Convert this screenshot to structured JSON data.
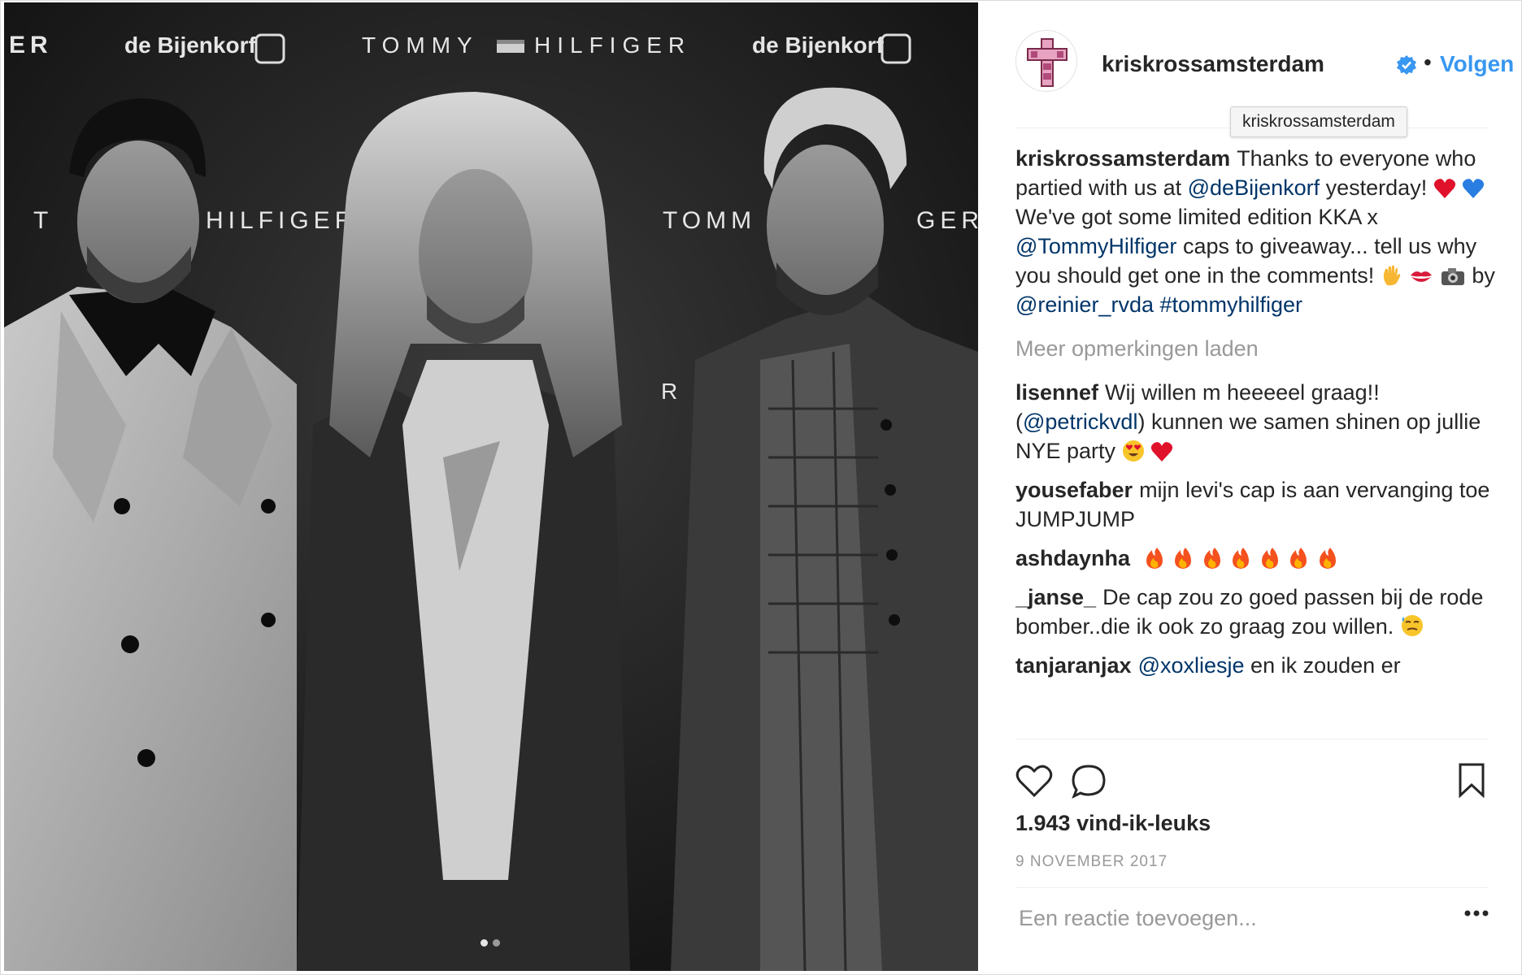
{
  "photo": {
    "backdrop_texts": [
      "ER",
      "de Bijenkorf",
      "TOMMY",
      "HILFIGER",
      "de Bijenkorf",
      "T",
      "HILFIGER",
      "TOMM",
      "GER",
      "R"
    ],
    "carousel_dots": 2,
    "active_dot": 0
  },
  "post": {
    "username": "kriskrossamsterdam",
    "follow_label": "Volgen",
    "separator": "•",
    "tooltip": "kriskrossamsterdam",
    "caption": {
      "user": "kriskrossamsterdam",
      "t1": "Thanks to everyone who partied with us at",
      "m1": "@deBijenkorf",
      "t2": "yesterday!",
      "t3": "We've got some limited edition KKA x",
      "m2": "@TommyHilfiger",
      "t4": "caps to giveaway... tell us why you should get one in the comments!",
      "t5": "by",
      "m3": "@reinier_rvda",
      "m4": "#tommyhilfiger"
    },
    "load_more": "Meer opmerkingen laden",
    "comments": [
      {
        "user": "lisennef",
        "t1": "Wij willen m heeeeel graag!! (",
        "m1": "@petrickvdl",
        "t2": ") kunnen we samen shinen op jullie NYE party"
      },
      {
        "user": "yousefaber",
        "t1": "mijn levi's cap is aan vervanging toe JUMPJUMP"
      },
      {
        "user": "ashdaynha",
        "t1": ""
      },
      {
        "user": "_janse_",
        "t1": "De cap zou zo goed passen bij de rode bomber..die ik ook zo graag zou willen."
      },
      {
        "user": "tanjaranjax",
        "m1": "@xoxliesje",
        "t1": "en ik zouden er"
      }
    ],
    "likes": "1.943 vind-ik-leuks",
    "date": "9 NOVEMBER 2017",
    "comment_placeholder": "Een reactie toevoegen..."
  },
  "icons": {
    "like": "heart-outline-icon",
    "comment": "speech-bubble-icon",
    "save": "bookmark-icon",
    "more": "ellipsis-icon",
    "verified": "verified-badge-icon"
  },
  "colors": {
    "accent": "#3897f0",
    "mention": "#003569",
    "muted": "#999999",
    "text": "#262626"
  }
}
